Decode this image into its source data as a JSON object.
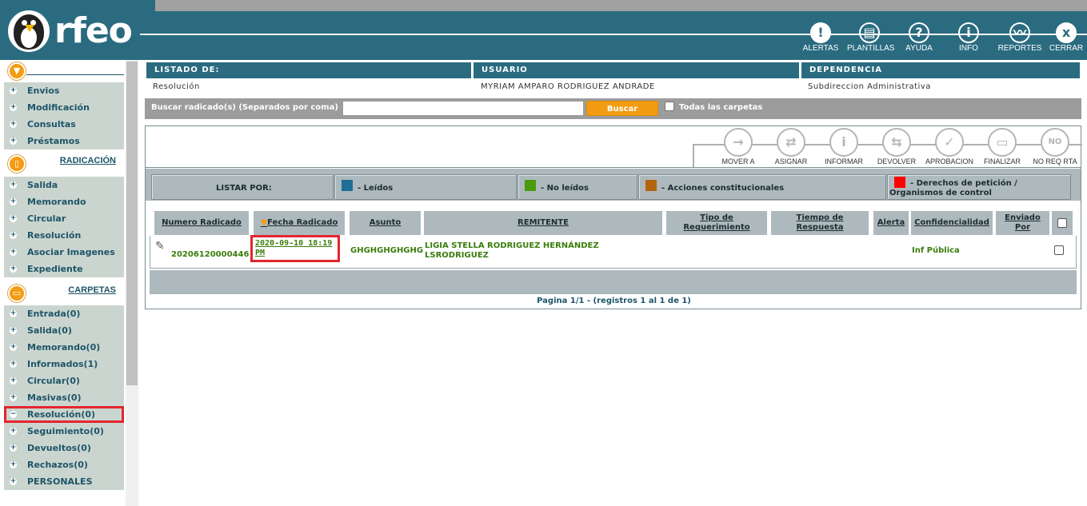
{
  "app": {
    "logo_text": "rfeo"
  },
  "header_buttons": [
    {
      "label": "ALERTAS",
      "icon": "!"
    },
    {
      "label": "PLANTILLAS",
      "icon": "▤"
    },
    {
      "label": "AYUDA",
      "icon": "?"
    },
    {
      "label": "INFO",
      "icon": "i"
    },
    {
      "label": "REPORTES",
      "icon": "〰"
    },
    {
      "label": "CERRAR",
      "icon": "x"
    }
  ],
  "sidebar": {
    "menu_items": [
      "Envios",
      "Modificación",
      "Consultas",
      "Préstamos"
    ],
    "radicacion_title": "RADICACIÓN",
    "radicacion_items": [
      "Salida",
      "Memorando",
      "Circular",
      "Resolución",
      "Asociar Imagenes",
      "Expediente"
    ],
    "carpetas_title": "CARPETAS",
    "carpetas_items": [
      "Entrada(0)",
      "Salida(0)",
      "Memorando(0)",
      "Informados(1)",
      "Circular(0)",
      "Masivas(0)",
      "Resolución(0)",
      "Seguimiento(0)",
      "Devueltos(0)",
      "Rechazos(0)",
      "PERSONALES"
    ]
  },
  "info": {
    "listado_label": "LISTADO DE:",
    "usuario_label": "USUARIO",
    "dependencia_label": "DEPENDENCIA",
    "listado_value": "Resolución",
    "usuario_value": "MYRIAM AMPARO RODRIGUEZ ANDRADE",
    "dependencia_value": "Subdireccion Administrativa"
  },
  "search": {
    "label": "Buscar radicado(s) (Separados por coma)",
    "value": "",
    "button": "Buscar",
    "all_folders": "Todas las carpetas"
  },
  "actions": [
    {
      "label": "MOVER A",
      "icon": "→"
    },
    {
      "label": "ASIGNAR",
      "icon": "⇄"
    },
    {
      "label": "INFORMAR",
      "icon": "i"
    },
    {
      "label": "DEVOLVER",
      "icon": "⇆"
    },
    {
      "label": "APROBACION",
      "icon": "✓"
    },
    {
      "label": "FINALIZAR",
      "icon": "▭"
    },
    {
      "label": "NO REQ RTA",
      "icon": "NO"
    }
  ],
  "legend": {
    "listar_por": "LISTAR POR:",
    "leidos": "- Leídos",
    "no_leidos": "- No leídos",
    "acciones": "- Acciones constitucionales",
    "derechos_line1": "- Derechos de petición /",
    "derechos_line2": "Organismos de control",
    "colors": {
      "leidos": "#1f6e94",
      "no_leidos": "#4a9a0e",
      "acciones": "#b3650e",
      "derechos": "#ff0000"
    }
  },
  "table": {
    "headers": {
      "numero": "Numero Radicado",
      "fecha": "Fecha Radicado",
      "asunto": "Asunto",
      "remitente": "REMITENTE",
      "tipo_1": "Tipo de",
      "tipo_2": "Requerimiento",
      "tiempo_1": "Tiempo de",
      "tiempo_2": "Respuesta",
      "alerta": "Alerta",
      "confidencialidad": "Confidencialidad",
      "enviado_1": "Enviado",
      "enviado_2": "Por"
    },
    "row": {
      "numero": "20206120000446",
      "fecha_1": "2020-09-10 18:19",
      "fecha_2": "PM",
      "asunto": "GHGHGHGHGHG",
      "remitente_1": "LIGIA STELLA RODRIGUEZ HERNÁNDEZ",
      "remitente_2": "LSRODRIGUEZ",
      "confidencialidad": "Inf Pública"
    }
  },
  "pager": {
    "text": "Pagina 1/1   -   (registros 1 al 1 de 1)"
  }
}
